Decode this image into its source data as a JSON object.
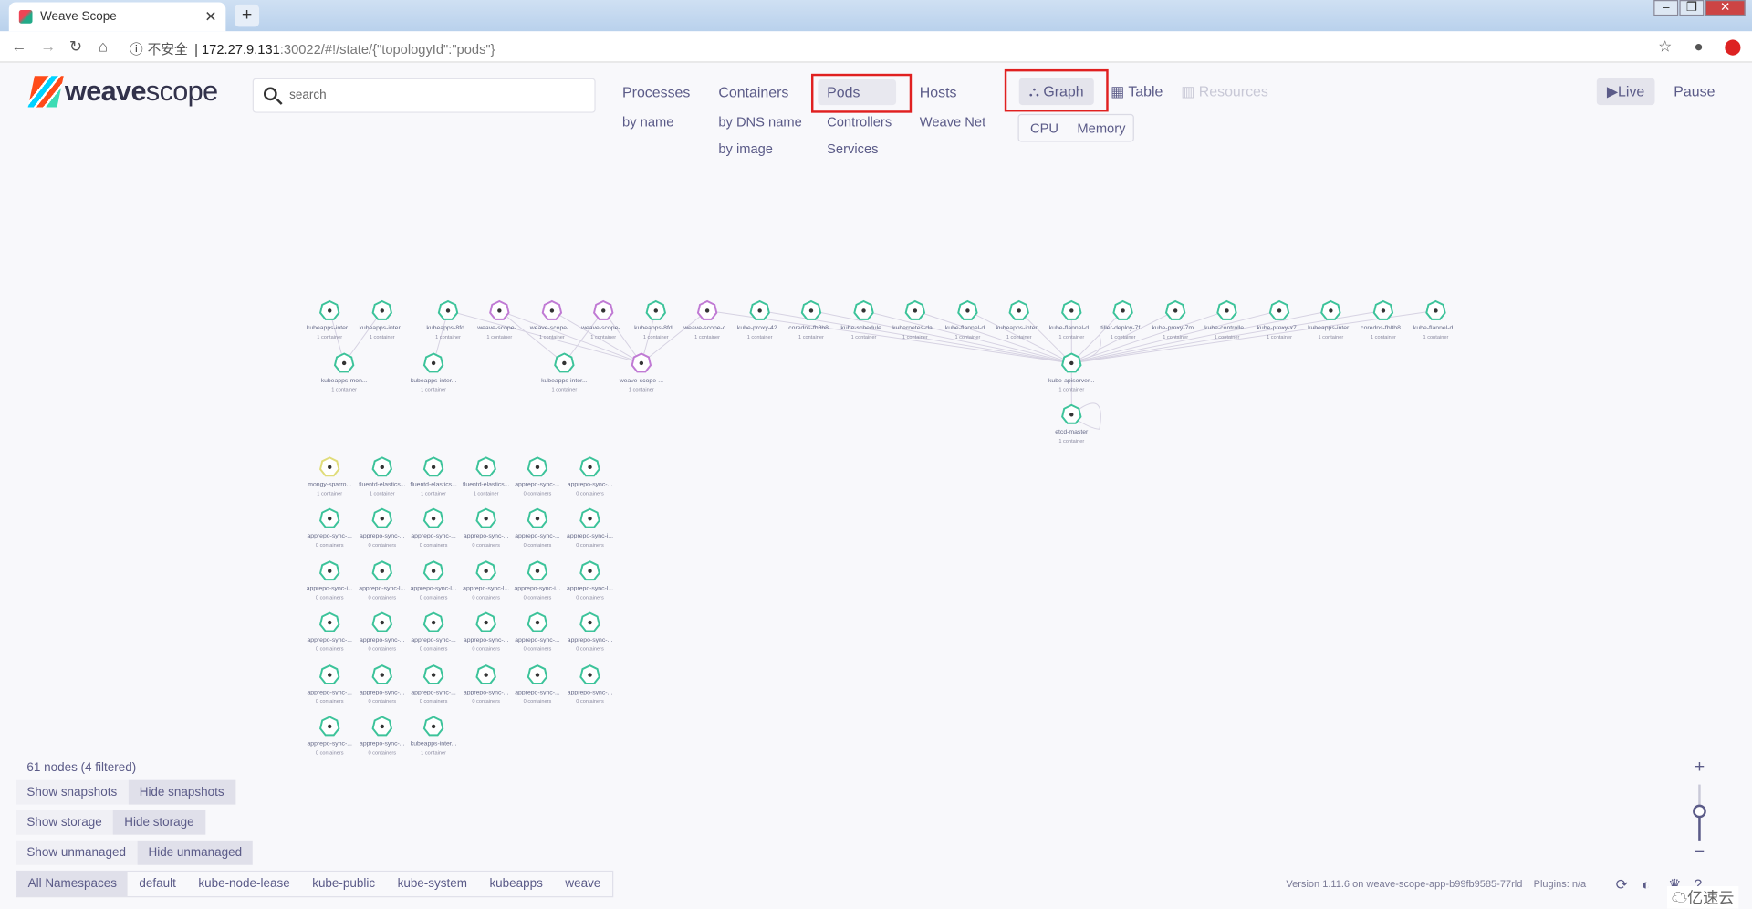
{
  "browser": {
    "tab_title": "Weave Scope",
    "insecure_label": "不安全",
    "url_host": "172.27.9.131",
    "url_path": ":30022/#!/state/{\"topologyId\":\"pods\"}"
  },
  "app": {
    "logo_weave": "weave",
    "logo_scope": "scope",
    "search_placeholder": "search"
  },
  "topologies": [
    {
      "label": "Processes",
      "subs": [
        "by name"
      ]
    },
    {
      "label": "Containers",
      "subs": [
        "by DNS name",
        "by image"
      ]
    },
    {
      "label": "Pods",
      "subs": [
        "Controllers",
        "Services"
      ],
      "active": true
    },
    {
      "label": "Hosts",
      "subs": [
        "Weave Net"
      ]
    }
  ],
  "views": {
    "graph": "Graph",
    "table": "Table",
    "resources": "Resources",
    "active": "Graph",
    "metrics": [
      "CPU",
      "Memory"
    ]
  },
  "live": {
    "live": "Live",
    "pause": "Pause"
  },
  "status": {
    "node_count": "61 nodes (4 filtered)"
  },
  "toggles": [
    [
      "Show snapshots",
      "Hide snapshots"
    ],
    [
      "Show storage",
      "Hide storage"
    ],
    [
      "Show unmanaged",
      "Hide unmanaged"
    ]
  ],
  "namespaces": [
    "All Namespaces",
    "default",
    "kube-node-lease",
    "kube-public",
    "kube-system",
    "kubeapps",
    "weave"
  ],
  "footer": {
    "version": "Version 1.11.6 on weave-scope-app-b99fb9585-77rld",
    "plugins": "Plugins: n/a"
  },
  "watermark": "亿速云",
  "colors": {
    "green": "#3cc39a",
    "purple": "#c07ad4",
    "yellow": "#e0dc7a",
    "highlight": "#e02020"
  },
  "graph": {
    "top_row": [
      {
        "label": "kubeapps-inter...",
        "sub": "1 container",
        "color": "green"
      },
      {
        "label": "kubeapps-inter...",
        "sub": "1 container",
        "color": "green"
      },
      {
        "label": "kubeapps-8fd...",
        "sub": "1 container",
        "color": "green"
      },
      {
        "label": "weave-scope-...",
        "sub": "1 container",
        "color": "purple"
      },
      {
        "label": "weave-scope-...",
        "sub": "1 container",
        "color": "purple"
      },
      {
        "label": "weave-scope-...",
        "sub": "1 container",
        "color": "purple"
      },
      {
        "label": "kubeapps-8fd...",
        "sub": "1 container",
        "color": "green"
      },
      {
        "label": "weave-scope-c...",
        "sub": "1 container",
        "color": "purple"
      },
      {
        "label": "kube-proxy-42...",
        "sub": "1 container",
        "color": "green"
      },
      {
        "label": "coredns-fb8b8...",
        "sub": "1 container",
        "color": "green"
      },
      {
        "label": "kube-schedule...",
        "sub": "1 container",
        "color": "green"
      },
      {
        "label": "kubernetes-da...",
        "sub": "1 container",
        "color": "green"
      },
      {
        "label": "kube-flannel-d...",
        "sub": "1 container",
        "color": "green"
      },
      {
        "label": "kubeapps-inter...",
        "sub": "1 container",
        "color": "green"
      },
      {
        "label": "kube-flannel-d...",
        "sub": "1 container",
        "color": "green"
      },
      {
        "label": "tiller-deploy-7f...",
        "sub": "1 container",
        "color": "green"
      },
      {
        "label": "kube-proxy-7m...",
        "sub": "1 container",
        "color": "green"
      },
      {
        "label": "kube-controlle...",
        "sub": "1 container",
        "color": "green"
      },
      {
        "label": "kube-proxy-x7...",
        "sub": "1 container",
        "color": "green"
      },
      {
        "label": "kubeapps-inter...",
        "sub": "1 container",
        "color": "green"
      },
      {
        "label": "coredns-fb8b8...",
        "sub": "1 container",
        "color": "green"
      },
      {
        "label": "kube-flannel-d...",
        "sub": "1 container",
        "color": "green"
      }
    ],
    "second_row": [
      {
        "label": "kubeapps-mon...",
        "sub": "1 container",
        "color": "green"
      },
      {
        "label": "kubeapps-inter...",
        "sub": "1 container",
        "color": "green"
      },
      {
        "label": "kubeapps-inter...",
        "sub": "1 container",
        "color": "green"
      },
      {
        "label": "weave-scope-...",
        "sub": "1 container",
        "color": "purple"
      },
      {
        "label": "kube-apiserver...",
        "sub": "1 container",
        "color": "green"
      },
      {
        "label": "etcd-master",
        "sub": "1 container",
        "color": "green"
      }
    ],
    "grid": [
      {
        "label": "mongy-sparro...",
        "sub": "1 container",
        "color": "yellow"
      },
      {
        "label": "fluentd-elastics...",
        "sub": "1 container",
        "color": "green"
      },
      {
        "label": "fluentd-elastics...",
        "sub": "1 container",
        "color": "green"
      },
      {
        "label": "fluentd-elastics...",
        "sub": "1 container",
        "color": "green"
      },
      {
        "label": "apprepo-sync-...",
        "sub": "0 containers",
        "color": "green"
      },
      {
        "label": "apprepo-sync-...",
        "sub": "0 containers",
        "color": "green"
      },
      {
        "label": "apprepo-sync-...",
        "sub": "0 containers",
        "color": "green"
      },
      {
        "label": "apprepo-sync-...",
        "sub": "0 containers",
        "color": "green"
      },
      {
        "label": "apprepo-sync-...",
        "sub": "0 containers",
        "color": "green"
      },
      {
        "label": "apprepo-sync-...",
        "sub": "0 containers",
        "color": "green"
      },
      {
        "label": "apprepo-sync-...",
        "sub": "0 containers",
        "color": "green"
      },
      {
        "label": "apprepo-sync-i...",
        "sub": "0 containers",
        "color": "green"
      },
      {
        "label": "apprepo-sync-i...",
        "sub": "0 containers",
        "color": "green"
      },
      {
        "label": "apprepo-sync-l...",
        "sub": "0 containers",
        "color": "green"
      },
      {
        "label": "apprepo-sync-l...",
        "sub": "0 containers",
        "color": "green"
      },
      {
        "label": "apprepo-sync-l...",
        "sub": "0 containers",
        "color": "green"
      },
      {
        "label": "apprepo-sync-i...",
        "sub": "0 containers",
        "color": "green"
      },
      {
        "label": "apprepo-sync-l...",
        "sub": "0 containers",
        "color": "green"
      },
      {
        "label": "apprepo-sync-...",
        "sub": "0 containers",
        "color": "green"
      },
      {
        "label": "apprepo-sync-...",
        "sub": "0 containers",
        "color": "green"
      },
      {
        "label": "apprepo-sync-...",
        "sub": "0 containers",
        "color": "green"
      },
      {
        "label": "apprepo-sync-...",
        "sub": "0 containers",
        "color": "green"
      },
      {
        "label": "apprepo-sync-...",
        "sub": "0 containers",
        "color": "green"
      },
      {
        "label": "apprepo-sync-...",
        "sub": "0 containers",
        "color": "green"
      },
      {
        "label": "apprepo-sync-...",
        "sub": "0 containers",
        "color": "green"
      },
      {
        "label": "apprepo-sync-...",
        "sub": "0 containers",
        "color": "green"
      },
      {
        "label": "apprepo-sync-...",
        "sub": "0 containers",
        "color": "green"
      },
      {
        "label": "apprepo-sync-...",
        "sub": "0 containers",
        "color": "green"
      },
      {
        "label": "apprepo-sync-...",
        "sub": "0 containers",
        "color": "green"
      },
      {
        "label": "apprepo-sync-...",
        "sub": "0 containers",
        "color": "green"
      },
      {
        "label": "apprepo-sync-...",
        "sub": "0 containers",
        "color": "green"
      },
      {
        "label": "apprepo-sync-...",
        "sub": "0 containers",
        "color": "green"
      },
      {
        "label": "kubeapps-inter...",
        "sub": "1 container",
        "color": "green"
      }
    ]
  }
}
